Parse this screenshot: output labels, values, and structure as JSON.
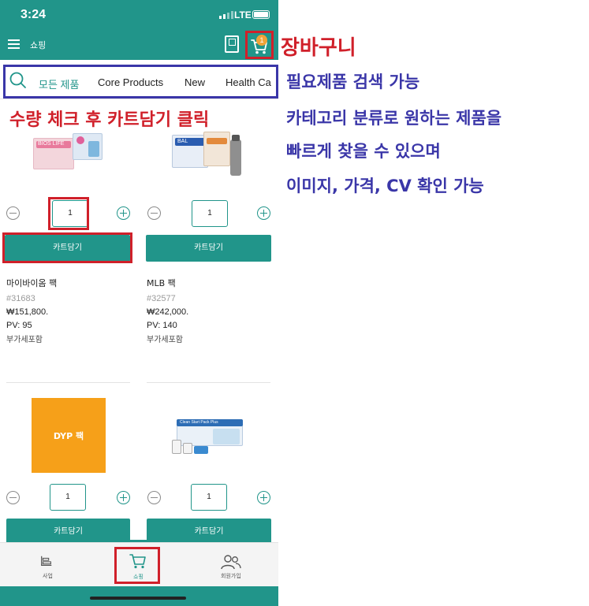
{
  "status_bar": {
    "time": "3:24",
    "network": "LTE"
  },
  "app_bar": {
    "title": "쇼핑",
    "cart_badge": "1"
  },
  "categories": [
    {
      "label": "모든 제품",
      "active": true
    },
    {
      "label": "Core Products",
      "active": false
    },
    {
      "label": "New",
      "active": false
    },
    {
      "label": "Health Ca",
      "active": false
    }
  ],
  "products": [
    {
      "name": "마이바이옴 팩",
      "code": "#31683",
      "price": "₩151,800.",
      "pv": "PV: 95",
      "vat": "부가세포함",
      "qty": "1",
      "cart_label": "카트담기",
      "image_label": "BIOS LIFE"
    },
    {
      "name": "MLB 팩",
      "code": "#32577",
      "price": "₩242,000.",
      "pv": "PV: 140",
      "vat": "부가세포함",
      "qty": "1",
      "cart_label": "카트담기",
      "image_label": "BAL"
    },
    {
      "name": "",
      "code": "",
      "price": "",
      "pv": "",
      "vat": "",
      "qty": "1",
      "cart_label": "카트담기",
      "image_label": "DYP 팩"
    },
    {
      "name": "",
      "code": "",
      "price": "",
      "pv": "",
      "vat": "",
      "qty": "1",
      "cart_label": "카트담기",
      "image_label": "Clean Start Pack Plus"
    }
  ],
  "bottom_nav": [
    {
      "label": "사업",
      "icon": "business-icon"
    },
    {
      "label": "쇼핑",
      "icon": "cart-icon",
      "active": true
    },
    {
      "label": "회원가입",
      "icon": "members-icon"
    }
  ],
  "annotations": {
    "cart": "장바구니",
    "add_to_cart": "수량 체크 후 카트담기 클릭",
    "search_lines": [
      "필요제품 검색 가능",
      "카테고리 분류로 원하는 제품을",
      "빠르게 찾을 수 있으며",
      "이미지, 가격, CV 확인 가능"
    ]
  },
  "colors": {
    "teal": "#21958a",
    "annotation_red": "#d0202a",
    "annotation_blue": "#3a36a8",
    "badge": "#f0a338"
  }
}
